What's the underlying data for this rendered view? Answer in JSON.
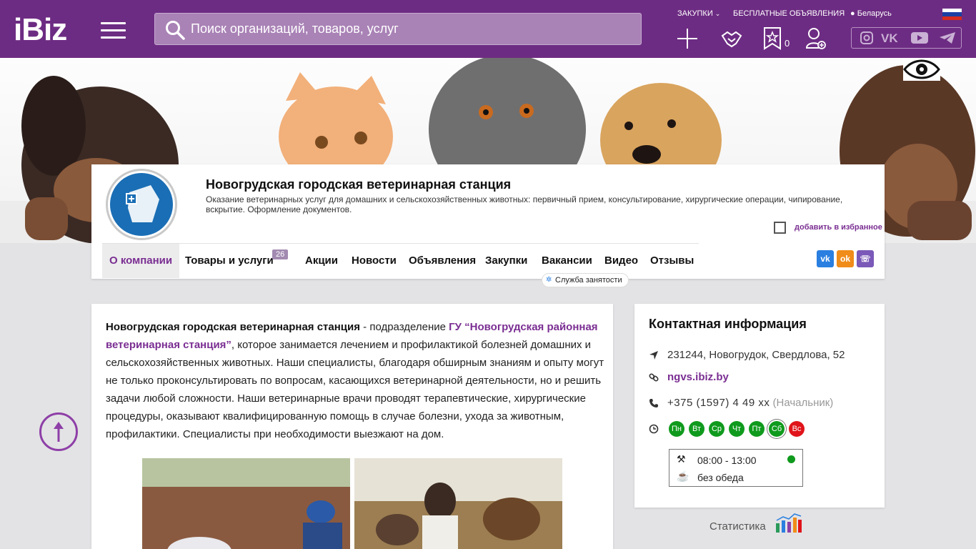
{
  "header": {
    "logo": "iBiz",
    "search_placeholder": "Поиск организаций, товаров, услуг",
    "links": [
      "ЗАКУПКИ",
      "БЕСПЛАТНЫЕ ОБЪЯВЛЕНИЯ"
    ],
    "region": "Беларусь",
    "favorites_count": "0"
  },
  "company": {
    "title": "Новогрудская городская ветеринарная станция",
    "description": "Оказание ветеринарных услуг для домашних и сельскохозяйственных животных: первичный прием, консультирование, хирургические операции, чипирование, вскрытие. Оформление документов.",
    "add_favorite": "добавить в избранное"
  },
  "nav": {
    "items": [
      "О компании",
      "Товары и услуги",
      "Акции",
      "Новости",
      "Объявления",
      "Закупки",
      "Вакансии",
      "Видео",
      "Отзывы"
    ],
    "goods_count": "26",
    "tooltip": "Служба занятости",
    "share": [
      "vk",
      "ok",
      "viber"
    ]
  },
  "about": {
    "name": "Новогрудская городская ветеринарная станция",
    "t1": " - подразделение ",
    "parent": "ГУ “Новогрудская районная ветеринарная станция”",
    "t2": ", которое занимается лечением и профилактикой болезней домашних и сельскохозяйственных животных. Наши специалисты, благодаря обширным знаниям и опыту могут не только проконсультировать по вопросам, касающихся ветеринарной деятельности, но и решить задачи любой сложности. Наши ветеринарные врачи проводят  терапевтические, хирургические процедуры, оказывают квалифицированную помощь в случае болезни, ухода за животным, профилактики. Специалисты при необходимости  выезжают на дом."
  },
  "contacts": {
    "title": "Контактная информация",
    "address": "231244, Новогрудок, Свердлова, 52",
    "site": "ngvs.ibiz.by",
    "phone": "+375 (1597) 4 49 xx",
    "phone_note": "(Начальник)",
    "days": [
      "Пн",
      "Вт",
      "Ср",
      "Чт",
      "Пт",
      "Сб",
      "Вс"
    ],
    "hours": "08:00 - 13:00",
    "lunch": "без обеда"
  },
  "stats_label": "Статистика",
  "colors": {
    "brand": "#6d2c83",
    "accent": "#7a2e92",
    "open_day": "#0f9a1d",
    "closed_day": "#e0141a"
  }
}
